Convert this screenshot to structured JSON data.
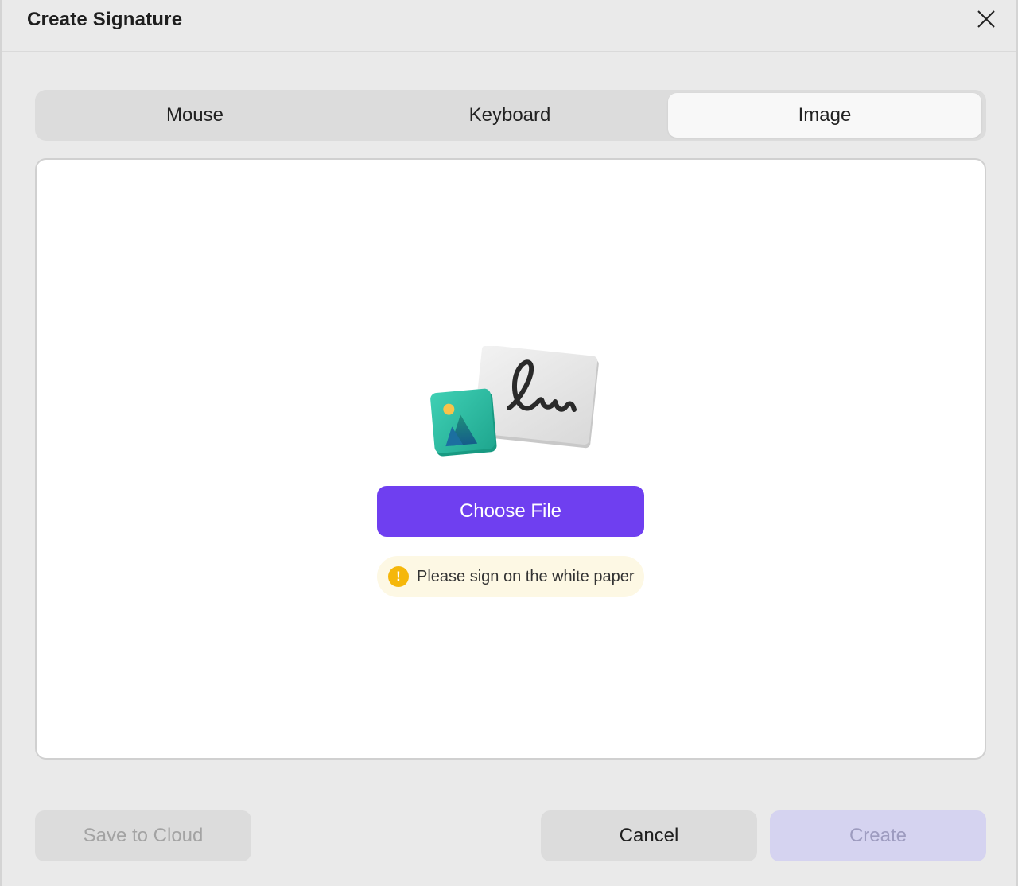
{
  "dialog": {
    "title": "Create Signature"
  },
  "tabs": [
    {
      "label": "Mouse",
      "selected": false
    },
    {
      "label": "Keyboard",
      "selected": false
    },
    {
      "label": "Image",
      "selected": true
    }
  ],
  "upload": {
    "choose_file_label": "Choose File",
    "hint_text": "Please sign on the white paper",
    "hint_icon": "!"
  },
  "footer": {
    "save_to_cloud_label": "Save to Cloud",
    "cancel_label": "Cancel",
    "create_label": "Create"
  },
  "colors": {
    "accent": "#6f3ff0",
    "warning": "#f5b70b"
  }
}
